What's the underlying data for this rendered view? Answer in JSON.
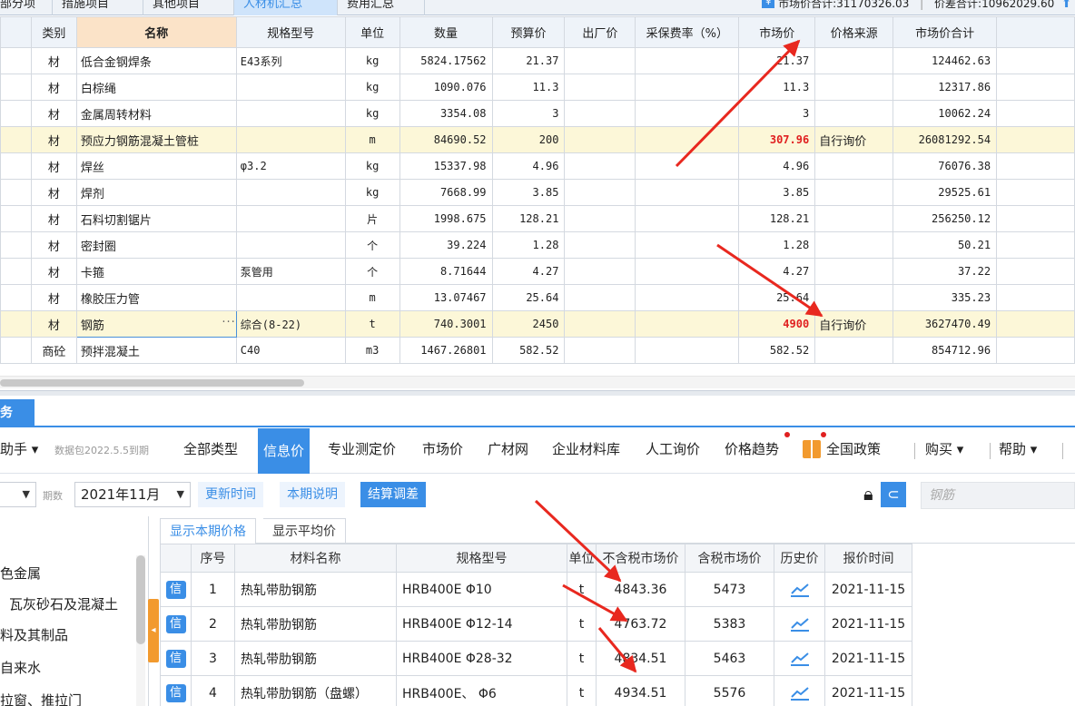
{
  "tabs": [
    "部分项",
    "措施项目",
    "其他项目",
    "人材机汇总",
    "费用汇总"
  ],
  "totals": {
    "market_total": "市场价合计:31170326.03",
    "diff_total": "价差合计:10962029.60"
  },
  "upper": {
    "headers": [
      "类别",
      "名称",
      "规格型号",
      "单位",
      "数量",
      "预算价",
      "出厂价",
      "采保费率（%）",
      "市场价",
      "价格来源",
      "市场价合计"
    ],
    "rows": [
      [
        "材",
        "低合金钢焊条",
        "E43系列",
        "kg",
        "5824.17562",
        "21.37",
        "",
        "",
        "21.37",
        "",
        "124462.63"
      ],
      [
        "材",
        "白棕绳",
        "",
        "kg",
        "1090.076",
        "11.3",
        "",
        "",
        "11.3",
        "",
        "12317.86"
      ],
      [
        "材",
        "金属周转材料",
        "",
        "kg",
        "3354.08",
        "3",
        "",
        "",
        "3",
        "",
        "10062.24"
      ],
      [
        "材",
        "预应力钢筋混凝土管桩",
        "",
        "m",
        "84690.52",
        "200",
        "",
        "",
        "307.96",
        "自行询价",
        "26081292.54"
      ],
      [
        "材",
        "焊丝",
        "φ3.2",
        "kg",
        "15337.98",
        "4.96",
        "",
        "",
        "4.96",
        "",
        "76076.38"
      ],
      [
        "材",
        "焊剂",
        "",
        "kg",
        "7668.99",
        "3.85",
        "",
        "",
        "3.85",
        "",
        "29525.61"
      ],
      [
        "材",
        "石料切割锯片",
        "",
        "片",
        "1998.675",
        "128.21",
        "",
        "",
        "128.21",
        "",
        "256250.12"
      ],
      [
        "材",
        "密封圈",
        "",
        "个",
        "39.224",
        "1.28",
        "",
        "",
        "1.28",
        "",
        "50.21"
      ],
      [
        "材",
        "卡箍",
        "泵管用",
        "个",
        "8.71644",
        "4.27",
        "",
        "",
        "4.27",
        "",
        "37.22"
      ],
      [
        "材",
        "橡胶压力管",
        "",
        "m",
        "13.07467",
        "25.64",
        "",
        "",
        "25.64",
        "",
        "335.23"
      ],
      [
        "材",
        "钢筋",
        "综合(8-22)",
        "t",
        "740.3001",
        "2450",
        "",
        "",
        "4900",
        "自行询价",
        "3627470.49"
      ],
      [
        "商砼",
        "预拌混凝土",
        "C40",
        "m3",
        "1467.26801",
        "582.52",
        "",
        "",
        "582.52",
        "",
        "854712.96"
      ]
    ],
    "highlight_rows": [
      3,
      10
    ],
    "ellipsis": "···"
  },
  "panel": {
    "tab_label": "务",
    "toolbar": {
      "helper": "助手",
      "package": "数据包2022.5.5到期",
      "items": [
        "全部类型",
        "信息价",
        "专业测定价",
        "市场价",
        "广材网",
        "企业材料库",
        "人工询价",
        "价格趋势",
        "全国政策",
        "购买",
        "帮助"
      ]
    },
    "filter": {
      "period_label": "期数",
      "period_value": "2021年11月",
      "update_time": "更新时间",
      "period_note": "本期说明",
      "settle_adjust": "结算调差",
      "search_placeholder": "钢筋"
    },
    "tree": [
      "色金属",
      "瓦灰砂石及混凝土",
      "料及其制品",
      "自来水",
      "拉窗、推拉门"
    ],
    "subtabs": [
      "显示本期价格",
      "显示平均价"
    ],
    "lower_headers": [
      "序号",
      "材料名称",
      "规格型号",
      "单位",
      "不含税市场价",
      "含税市场价",
      "历史价",
      "报价时间"
    ],
    "lower_rows": [
      {
        "badge": "信",
        "no": "1",
        "name": "热轧带肋钢筋",
        "spec": "HRB400E Φ10",
        "unit": "t",
        "price_ex": "4843.36",
        "price_in": "5473",
        "date": "2021-11-15"
      },
      {
        "badge": "信",
        "no": "2",
        "name": "热轧带肋钢筋",
        "spec": "HRB400E Φ12-14",
        "unit": "t",
        "price_ex": "4763.72",
        "price_in": "5383",
        "date": "2021-11-15"
      },
      {
        "badge": "信",
        "no": "3",
        "name": "热轧带肋钢筋",
        "spec": "HRB400E Φ28-32",
        "unit": "t",
        "price_ex": "4834.51",
        "price_in": "5463",
        "date": "2021-11-15"
      },
      {
        "badge": "信",
        "no": "4",
        "name": "热轧带肋钢筋（盘螺）",
        "spec": "HRB400E、 Φ6",
        "unit": "t",
        "price_ex": "4934.51",
        "price_in": "5576",
        "date": "2021-11-15"
      }
    ]
  },
  "colors": {
    "accent": "#3a8ee6",
    "highlight_row": "#fcf7d8",
    "alert_red": "#e02020",
    "arrow_red": "#e8281f"
  }
}
